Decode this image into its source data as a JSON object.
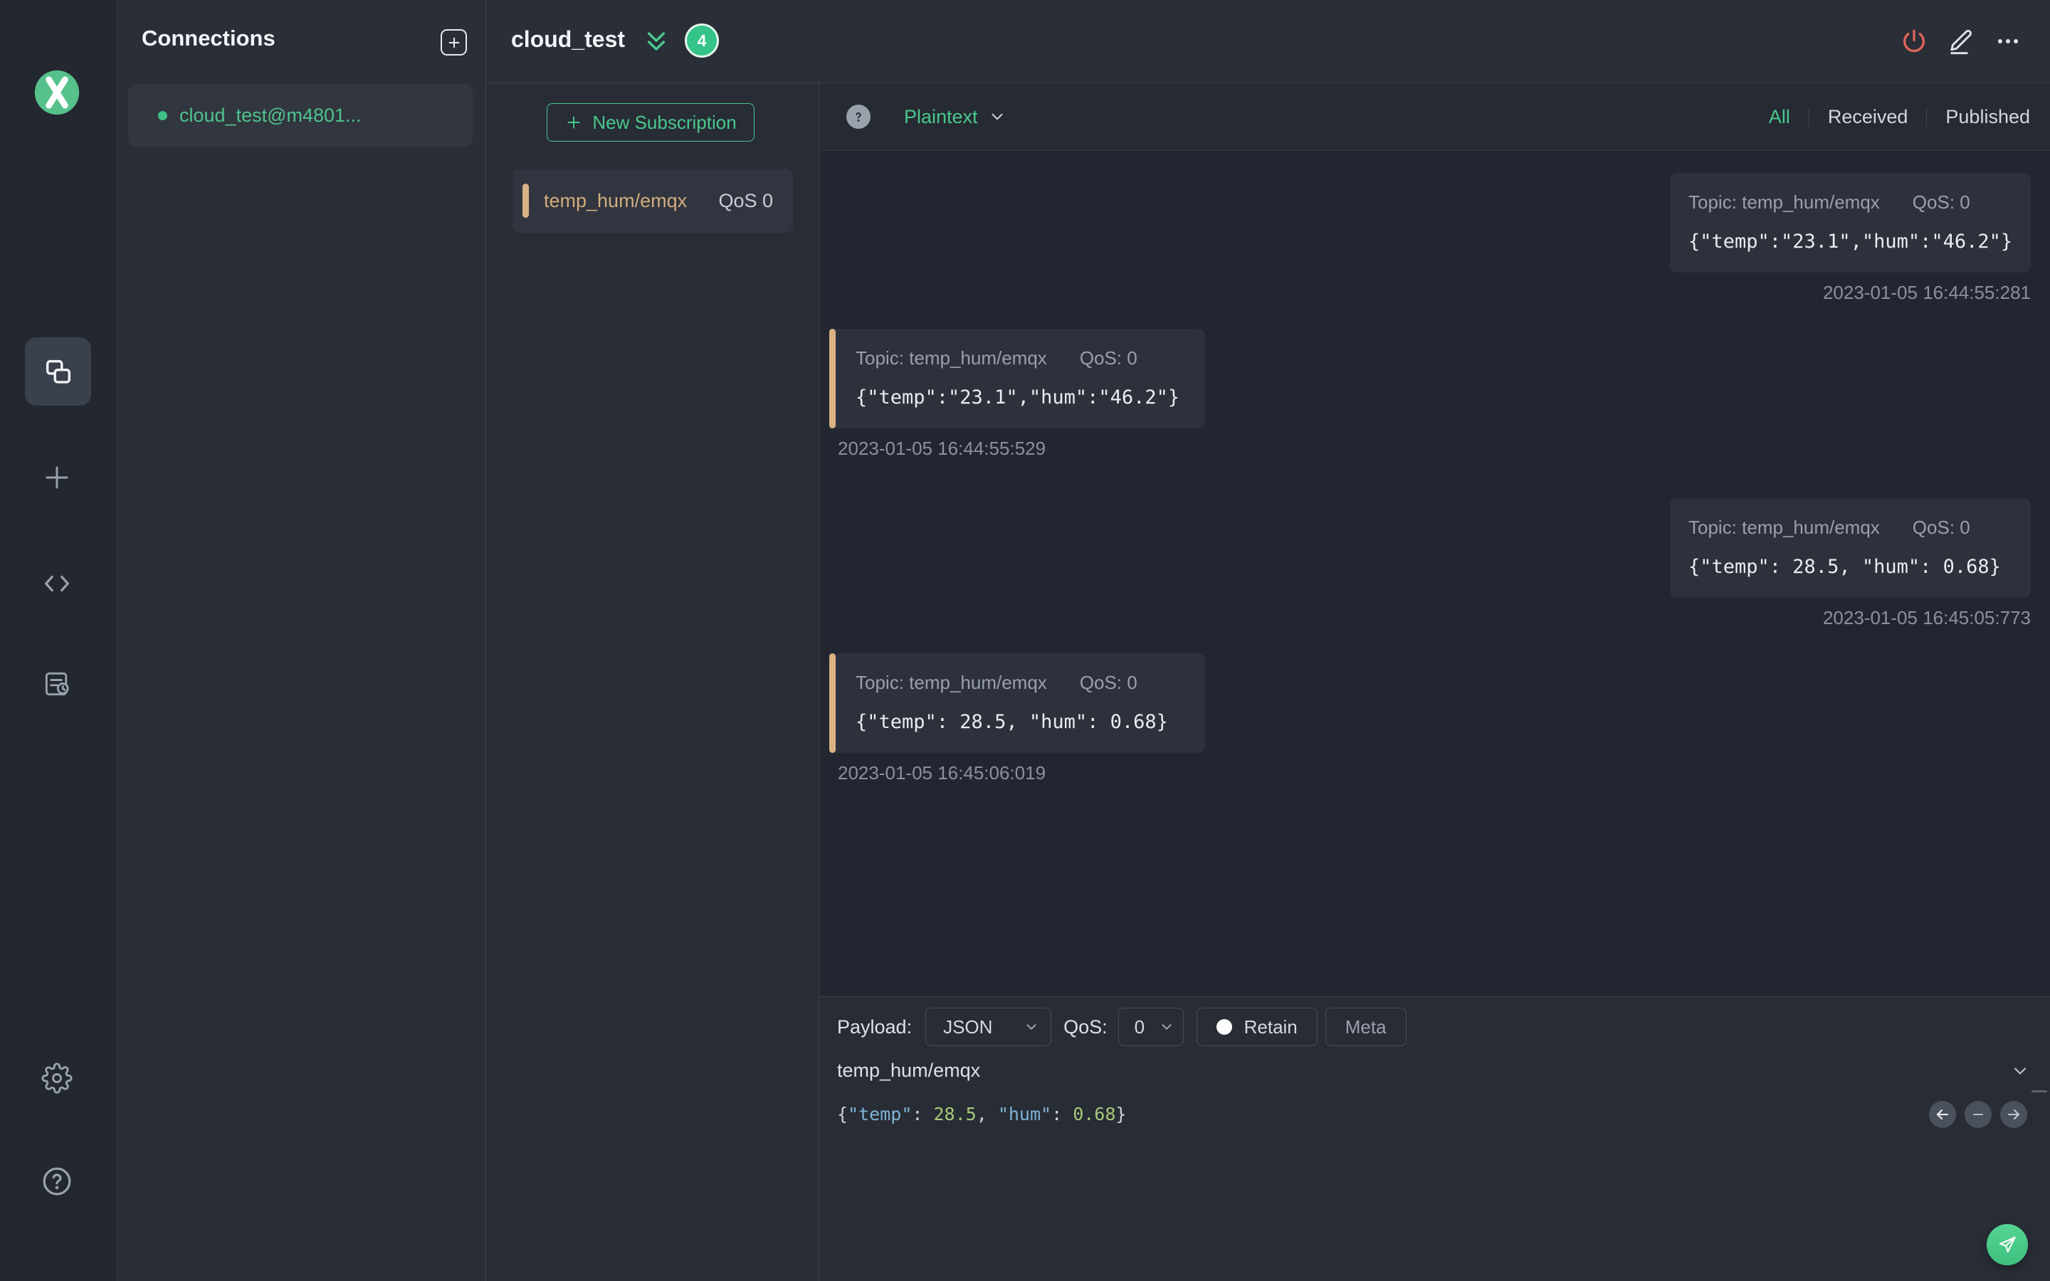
{
  "colors": {
    "accent_green": "#34c388",
    "topic_tan": "#dab385",
    "danger_red": "#e0655a",
    "editor_key_blue": "#7fb4d7",
    "editor_number_green": "#a6ca79",
    "panel_bg": "#2a2e37",
    "messages_bg": "#222630"
  },
  "connections_panel": {
    "title": "Connections",
    "items": [
      {
        "name": "cloud_test@m4801...",
        "status": "connected"
      }
    ]
  },
  "header": {
    "title": "cloud_test",
    "badge_count": "4"
  },
  "subscriptions_panel": {
    "new_subscription_label": "New Subscription",
    "items": [
      {
        "topic": "temp_hum/emqx",
        "qos": "QoS 0"
      }
    ]
  },
  "message_toolbar": {
    "format": "Plaintext",
    "filters": [
      "All",
      "Received",
      "Published"
    ],
    "active_filter": "All"
  },
  "messages": [
    {
      "type": "published",
      "topic_label": "Topic: temp_hum/emqx",
      "qos_label": "QoS: 0",
      "payload": "{\"temp\":\"23.1\",\"hum\":\"46.2\"}",
      "timestamp": "2023-01-05 16:44:55:281"
    },
    {
      "type": "received",
      "topic_label": "Topic: temp_hum/emqx",
      "qos_label": "QoS: 0",
      "payload": "{\"temp\":\"23.1\",\"hum\":\"46.2\"}",
      "timestamp": "2023-01-05 16:44:55:529"
    },
    {
      "type": "published",
      "topic_label": "Topic: temp_hum/emqx",
      "qos_label": "QoS: 0",
      "payload": "{\"temp\": 28.5, \"hum\": 0.68}",
      "timestamp": "2023-01-05 16:45:05:773"
    },
    {
      "type": "received",
      "topic_label": "Topic: temp_hum/emqx",
      "qos_label": "QoS: 0",
      "payload": "{\"temp\": 28.5, \"hum\": 0.68}",
      "timestamp": "2023-01-05 16:45:06:019"
    }
  ],
  "publish_panel": {
    "payload_label": "Payload:",
    "payload_format": "JSON",
    "qos_label": "QoS:",
    "qos_value": "0",
    "retain_label": "Retain",
    "meta_label": "Meta",
    "topic_value": "temp_hum/emqx",
    "editor": {
      "open_brace": "{",
      "key1": "\"temp\"",
      "colon1": ": ",
      "value1": "28.5",
      "comma": ", ",
      "key2": "\"hum\"",
      "colon2": ": ",
      "value2": "0.68",
      "close_brace": "}"
    }
  }
}
